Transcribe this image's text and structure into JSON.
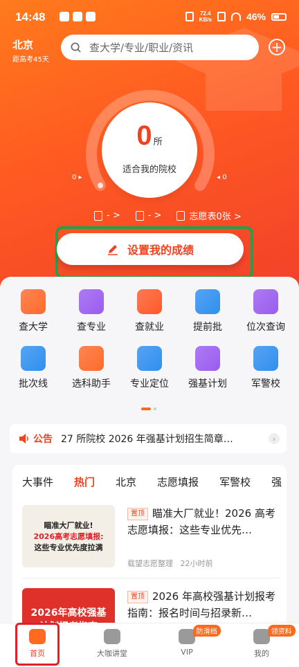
{
  "status_bar": {
    "time": "14:48",
    "net_speed_value": "72.4",
    "net_speed_unit": "KB/s",
    "battery": "46%"
  },
  "location": {
    "city": "北京",
    "countdown": "距高考45天"
  },
  "search": {
    "placeholder": "查大学/专业/职业/资讯"
  },
  "gauge": {
    "count": "0",
    "unit": "所",
    "caption": "适合我的院校",
    "left_value": "0",
    "right_value": "0"
  },
  "stats": {
    "item1": "- >",
    "item2": "- >",
    "item3": "志愿表0张 >"
  },
  "score_button": {
    "label": "设置我的成绩"
  },
  "grid_row1": [
    {
      "label": "查大学",
      "icon": "school-icon",
      "color": "#ff6a2a"
    },
    {
      "label": "查专业",
      "icon": "book-icon",
      "color": "#9a5cf0"
    },
    {
      "label": "查就业",
      "icon": "briefcase-icon",
      "color": "#ff5a2a"
    },
    {
      "label": "提前批",
      "icon": "calendar-check-icon",
      "color": "#2f8ff0"
    },
    {
      "label": "位次查询",
      "icon": "chart-icon",
      "color": "#9a5cf0"
    }
  ],
  "grid_row2": [
    {
      "label": "批次线",
      "icon": "trend-icon",
      "color": "#2f8ff0"
    },
    {
      "label": "选科助手",
      "icon": "cards-icon",
      "color": "#ff6a2a"
    },
    {
      "label": "专业定位",
      "icon": "document-icon",
      "color": "#2f8ff0"
    },
    {
      "label": "强基计划",
      "icon": "flag-doc-icon",
      "color": "#9a5cf0"
    },
    {
      "label": "军警校",
      "icon": "shield-star-icon",
      "color": "#2f8ff0"
    }
  ],
  "notice": {
    "tag": "公告",
    "text": "27 所院校 2026 年强基计划招生简章…"
  },
  "tabs": [
    "大事件",
    "热门",
    "北京",
    "志愿填报",
    "军警校",
    "强"
  ],
  "articles": [
    {
      "pin": "置顶",
      "title": "瞄准大厂就业！2026 高考志愿填报：这些专业优先…",
      "meta_source": "载望志愿整理",
      "meta_time": "22小时前",
      "thumb_line1": "瞄准大厂就业!",
      "thumb_line2": "2026高考志愿填报:",
      "thumb_line3": "这些专业优先度拉满"
    },
    {
      "pin": "置顶",
      "title": "2026 年高校强基计划报考指南：报名时间与招录新…",
      "thumb_line1": "2026年高校强基",
      "thumb_line2": "计划报考指南"
    }
  ],
  "bottom_nav": [
    {
      "label": "首页",
      "icon": "home-icon"
    },
    {
      "label": "大咖讲堂",
      "icon": "video-icon"
    },
    {
      "label": "VIP",
      "icon": "vip-icon",
      "badge": "防滑档"
    },
    {
      "label": "我的",
      "icon": "profile-icon",
      "badge": "领资料"
    }
  ],
  "colors": {
    "brand": "#ff6a20",
    "accent": "#f0421f",
    "highlight": "#2e9c46"
  }
}
